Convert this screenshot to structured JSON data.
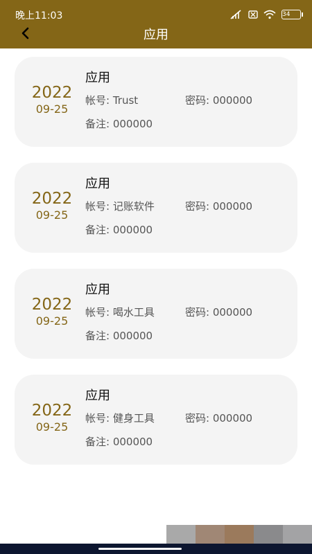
{
  "status_bar": {
    "time": "晚上11:03",
    "battery": "34"
  },
  "header": {
    "title": "应用"
  },
  "labels": {
    "account": "帐号: ",
    "password": "密码: ",
    "note": "备注: "
  },
  "records": [
    {
      "year": "2022",
      "month_day": "09-25",
      "title": "应用",
      "account": "Trust",
      "password": "000000",
      "note": "000000"
    },
    {
      "year": "2022",
      "month_day": "09-25",
      "title": "应用",
      "account": "记账软件",
      "password": "000000",
      "note": "000000"
    },
    {
      "year": "2022",
      "month_day": "09-25",
      "title": "应用",
      "account": "喝水工具",
      "password": "000000",
      "note": "000000"
    },
    {
      "year": "2022",
      "month_day": "09-25",
      "title": "应用",
      "account": "健身工具",
      "password": "000000",
      "note": "000000"
    }
  ],
  "colors": {
    "header_bg": "#846617",
    "accent": "#846617",
    "card_bg": "#f4f4f4"
  },
  "icons": {
    "back": "chevron-left-icon",
    "signal": "signal-off-icon",
    "sim": "sim-icon",
    "wifi": "wifi-icon",
    "battery": "battery-icon"
  }
}
